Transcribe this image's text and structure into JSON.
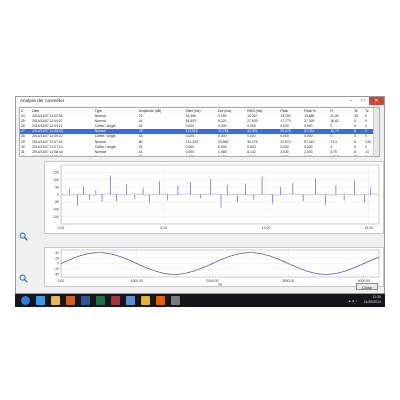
{
  "window": {
    "title": "Analyse der Ausreißer",
    "min_glyph": "–",
    "max_glyph": "□",
    "close_glyph": "✕"
  },
  "table": {
    "columns": [
      "#",
      "Date",
      "Type",
      "Amplitude (dB)",
      "Start (ms)",
      "Dur (ms)",
      "RMS (ms)",
      "Peak",
      "Peak %",
      "R",
      "Ts",
      "Tc"
    ],
    "rows": [
      [
        "24",
        "2014/11/07 11:00:50",
        "Normal",
        "21",
        "15,356",
        "2,150",
        "16,207",
        "13,752",
        "13,685",
        "11,06",
        "33",
        "0"
      ],
      [
        "25",
        "2014/11/07 11:04:07",
        "Normal",
        "44",
        "64,303",
        "5,220",
        "27,929",
        "17,770",
        "17,025",
        "16,61",
        "8",
        "0"
      ],
      [
        "26",
        "2014/11/07 11:04:11",
        "Cdifex / Angle",
        "32",
        "0,000",
        "0,000",
        "0,000",
        "0,000",
        "0,000",
        "0",
        "0",
        "0"
      ],
      [
        "27",
        "2014/11/07 11:08:25",
        "Normal",
        "78",
        "113,518",
        "22,754",
        "44,301",
        "59,476",
        "67,014",
        "10,79",
        "6",
        "2"
      ],
      [
        "28",
        "2014/11/07 11:09:22",
        "Cdifex / Angle",
        "33",
        "0,000",
        "0,000",
        "0,000",
        "0,000",
        "0,000",
        "0",
        "0",
        "0"
      ],
      [
        "29",
        "2014/11/07 11:07:01",
        "Normal",
        "80",
        "121,203",
        "20,960",
        "36,275",
        "22,973",
        "57,442",
        "73,3",
        "8",
        "130"
      ],
      [
        "30",
        "2014/11/07 11:07:14",
        "Cdifex / Angle",
        "31",
        "0,000",
        "0,000",
        "0,000",
        "0,000",
        "0,000",
        "0",
        "0",
        "0"
      ],
      [
        "31",
        "2014/11/07 11:08:44",
        "Normal",
        "14",
        "0,000",
        "1,580",
        "8,142",
        "2,030",
        "2,003",
        "3,75",
        "8",
        "14"
      ],
      [
        "32",
        "2014/11/07 11:09:00",
        "Normal",
        "74",
        "1,867",
        "8,590",
        "0,040",
        "0,000",
        "0,000",
        "145,31",
        "73",
        "0"
      ]
    ],
    "selected_row": 3
  },
  "chart_data": [
    {
      "type": "line",
      "title": "",
      "xlabel": "",
      "ylabel": "",
      "xlim": [
        0,
        15.5
      ],
      "ylim": [
        -200,
        200
      ],
      "x_ticks": [
        "0,00",
        "5,00",
        "10,00",
        "15,00"
      ],
      "x_tick_values": [
        0,
        5,
        10,
        15
      ],
      "y_ticks": [
        "150",
        "100",
        "50",
        "0",
        "-50",
        "-100",
        "-150"
      ],
      "y_tick_values": [
        150,
        100,
        50,
        0,
        -50,
        -100,
        -150
      ],
      "grid": true,
      "series": [
        {
          "color": "#4a44a8",
          "spikes": [
            [
              0.4,
              40
            ],
            [
              0.8,
              -75
            ],
            [
              1.1,
              55
            ],
            [
              1.4,
              -35
            ],
            [
              1.7,
              30
            ],
            [
              2.0,
              -50
            ],
            [
              2.4,
              130
            ],
            [
              2.7,
              -45
            ],
            [
              3.2,
              70
            ],
            [
              3.6,
              -30
            ],
            [
              4.0,
              45
            ],
            [
              4.3,
              -60
            ],
            [
              4.8,
              90
            ],
            [
              5.2,
              -40
            ],
            [
              5.7,
              60
            ],
            [
              6.3,
              85
            ],
            [
              6.8,
              -25
            ],
            [
              7.3,
              105
            ],
            [
              7.8,
              -90
            ],
            [
              8.1,
              65
            ],
            [
              8.6,
              -50
            ],
            [
              9.0,
              75
            ],
            [
              9.4,
              -35
            ],
            [
              9.8,
              120
            ],
            [
              10.3,
              -60
            ],
            [
              10.7,
              50
            ],
            [
              11.3,
              80
            ],
            [
              11.8,
              -45
            ],
            [
              12.4,
              110
            ],
            [
              12.9,
              -70
            ],
            [
              13.4,
              60
            ],
            [
              13.8,
              -40
            ],
            [
              14.3,
              95
            ],
            [
              14.8,
              -55
            ],
            [
              15.1,
              50
            ]
          ]
        }
      ]
    },
    {
      "type": "line",
      "title": "",
      "xlabel": "ms",
      "ylabel": "",
      "xlim": [
        0,
        4200
      ],
      "ylim": [
        -50,
        50
      ],
      "x_ticks": [
        "0,00",
        "1000,00",
        "2000,00",
        "3000,00",
        "4000,00"
      ],
      "x_tick_values": [
        0,
        1000,
        2000,
        3000,
        4000
      ],
      "y_ticks": [
        "40",
        "20",
        "0",
        "-20",
        "-40"
      ],
      "y_tick_values": [
        40,
        20,
        0,
        -20,
        -40
      ],
      "grid": true,
      "series": [
        {
          "color": "#4a44a8",
          "amplitude": 40,
          "period": 2000,
          "phase": 0
        }
      ]
    }
  ],
  "close_button": {
    "label": "Close"
  },
  "taskbar": {
    "icons": [
      {
        "name": "start-orb-icon",
        "color": "#2f7de0"
      },
      {
        "name": "internet-explorer-icon",
        "color": "#3a9be8"
      },
      {
        "name": "file-explorer-icon",
        "color": "#e8b84a"
      },
      {
        "name": "media-player-icon",
        "color": "#d06020"
      },
      {
        "name": "word-icon",
        "color": "#2b5797"
      },
      {
        "name": "excel-icon",
        "color": "#1e7145"
      },
      {
        "name": "access-icon",
        "color": "#a4373a"
      },
      {
        "name": "app-icon",
        "color": "#5c8fd6"
      },
      {
        "name": "chrome-icon",
        "color": "#e9b02e"
      },
      {
        "name": "firefox-icon",
        "color": "#e66000"
      },
      {
        "name": "settings-icon",
        "color": "#7a7a7a"
      }
    ],
    "clock_time": "11:20",
    "clock_date": "11/20/2014"
  }
}
